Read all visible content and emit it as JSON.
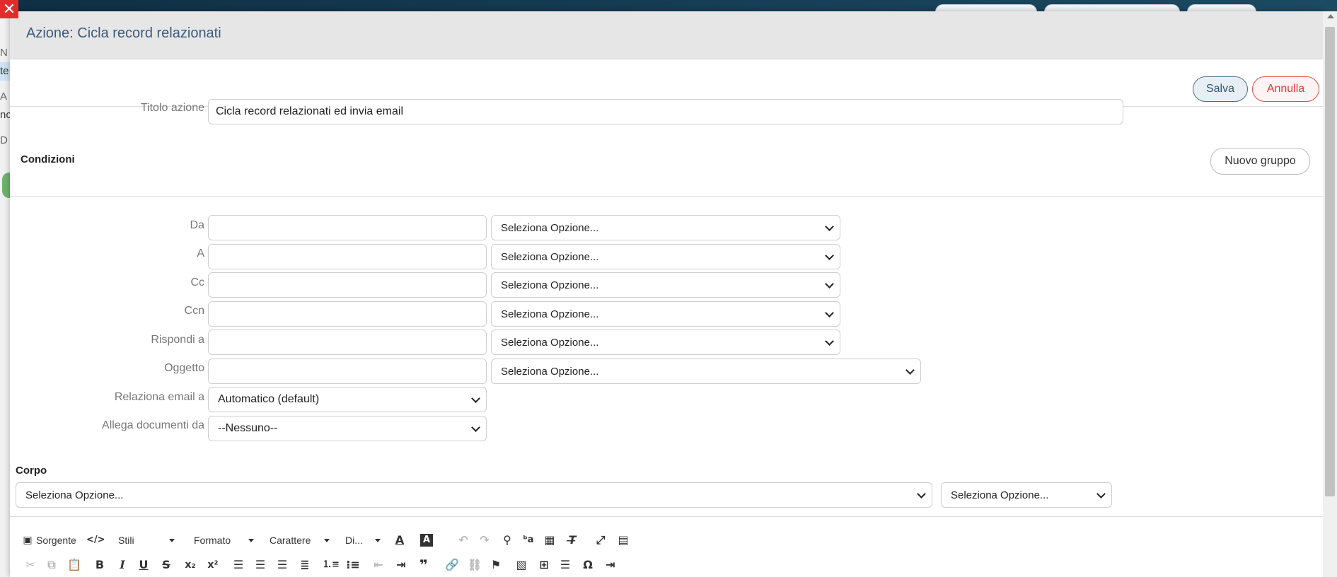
{
  "modal": {
    "title": "Azione: Cicla record relazionati",
    "close_label": "✕"
  },
  "actions": {
    "save_label": "Salva",
    "cancel_label": "Annulla"
  },
  "form": {
    "titolo_label": "Titolo azione",
    "titolo_value": "Cicla record relazionati ed invia email",
    "conditions_title": "Condizioni",
    "new_group_label": "Nuovo gruppo",
    "fields": [
      {
        "label": "Da",
        "value": "",
        "option": "Seleziona Opzione..."
      },
      {
        "label": "A",
        "value": "",
        "option": "Seleziona Opzione..."
      },
      {
        "label": "Cc",
        "value": "",
        "option": "Seleziona Opzione..."
      },
      {
        "label": "Ccn",
        "value": "",
        "option": "Seleziona Opzione..."
      },
      {
        "label": "Rispondi a",
        "value": "",
        "option": "Seleziona Opzione..."
      },
      {
        "label": "Oggetto",
        "value": "",
        "option": "Seleziona Opzione..."
      }
    ],
    "relaziona_label": "Relaziona email a",
    "relaziona_value": "Automatico (default)",
    "allega_label": "Allega documenti da",
    "allega_value": "--Nessuno--",
    "corpo_title": "Corpo",
    "corpo_option_1": "Seleziona Opzione...",
    "corpo_option_2": "Seleziona Opzione..."
  },
  "editor": {
    "source_label": "Sorgente",
    "styles_label": "Stili",
    "format_label": "Formato",
    "font_label": "Carattere",
    "size_label": "Di..."
  },
  "background": {
    "left_fragments": [
      "N",
      "te",
      "A",
      "nc",
      "D"
    ]
  }
}
